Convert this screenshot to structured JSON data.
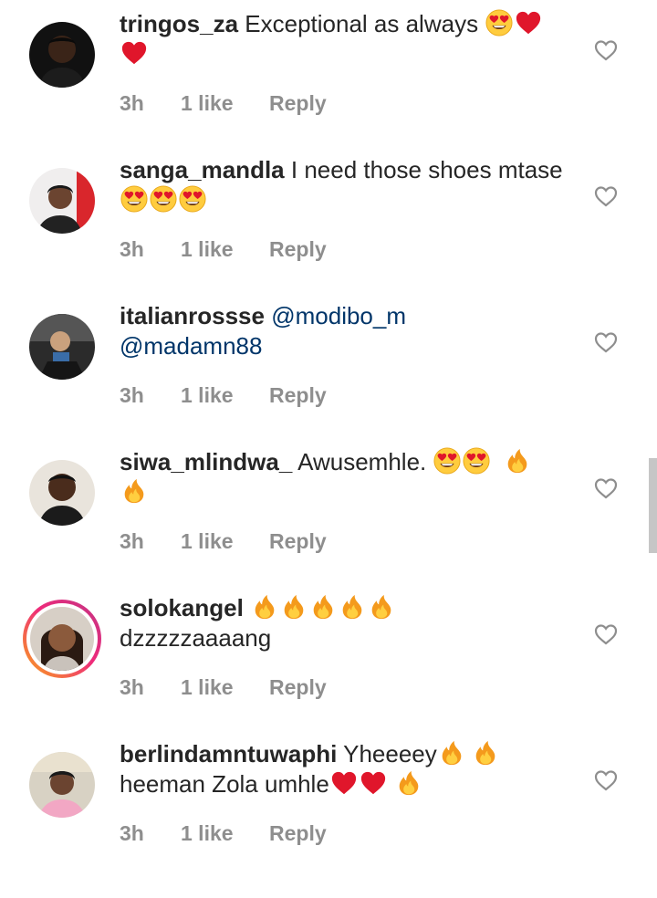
{
  "comments": [
    {
      "username": "tringos_za",
      "text": "Exceptional as always ",
      "emojis": [
        "heart-eyes-emoji",
        "red-heart-emoji",
        "red-heart-emoji"
      ],
      "time": "3h",
      "likes": "1 like",
      "reply": "Reply"
    },
    {
      "username": "sanga_mandla",
      "text": "I need those shoes mtase",
      "emojis": [
        "heart-eyes-emoji",
        "heart-eyes-emoji",
        "heart-eyes-emoji"
      ],
      "time": "3h",
      "likes": "1 like",
      "reply": "Reply"
    },
    {
      "username": "italianrossse",
      "mention1": "@modibo_m",
      "mention2": "@madamn88",
      "time": "3h",
      "likes": "1 like",
      "reply": "Reply"
    },
    {
      "username": "siwa_mlindwa_",
      "text": "Awusemhle. ",
      "emojis": [
        "heart-eyes-emoji",
        "heart-eyes-emoji",
        "fire-emoji",
        "fire-emoji"
      ],
      "time": "3h",
      "likes": "1 like",
      "reply": "Reply"
    },
    {
      "username": "solokangel",
      "text_after": "dzzzzzaaaang",
      "emojis": [
        "fire-emoji",
        "fire-emoji",
        "fire-emoji",
        "fire-emoji",
        "fire-emoji"
      ],
      "time": "3h",
      "likes": "1 like",
      "reply": "Reply"
    },
    {
      "username": "berlindamntuwaphi",
      "text": "Yheeeey",
      "text2": "heeman Zola umhle",
      "emojis": [
        "fire-emoji",
        "fire-emoji",
        "red-heart-emoji",
        "red-heart-emoji",
        "fire-emoji"
      ],
      "time": "3h",
      "likes": "1 like",
      "reply": "Reply"
    }
  ],
  "icons": {
    "like": "heart-outline-icon"
  },
  "colors": {
    "username": "#262626",
    "meta": "#8e8e8e",
    "mention": "#003569",
    "heart": "#e0162b"
  }
}
